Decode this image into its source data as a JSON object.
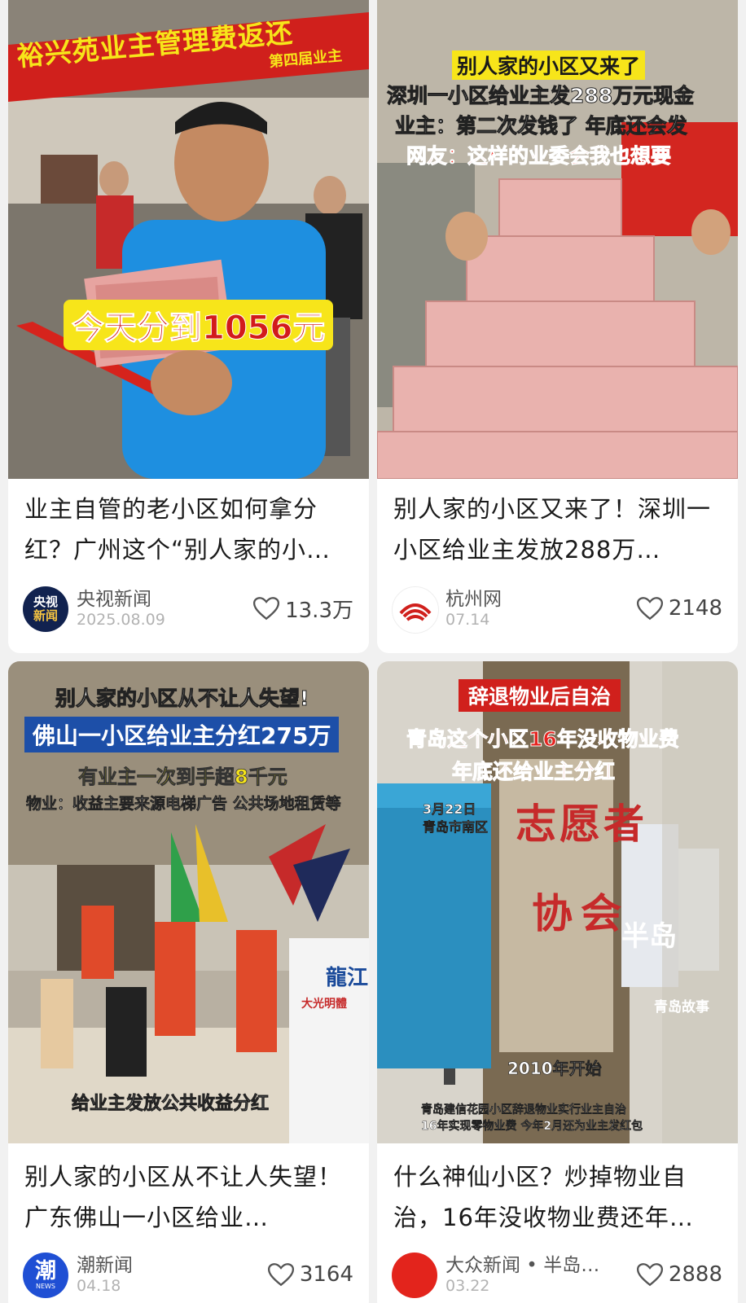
{
  "feed": {
    "cards": [
      {
        "title": "业主自管的老小区如何拿分红？广州这个“别人家的小…",
        "source": "央视新闻",
        "date": "2025.08.09",
        "likes": "13.3万",
        "avatar_text": [
          "央视",
          "新闻"
        ],
        "overlay": {
          "banner_main": "裕兴苑业主管理费返还",
          "banner_sub": "第四届业主",
          "sticker": "今天分到1056元"
        }
      },
      {
        "title": "别人家的小区又来了！深圳一小区给业主发放288万…",
        "source": "杭州网",
        "date": "07.14",
        "likes": "2148",
        "overlay": {
          "line1": "别人家的小区又来了",
          "line2": "深圳一小区给业主发288万元现金",
          "line3": "业主：第二次发钱了 年底还会发",
          "line4": "网友：这样的业委会我也想要"
        }
      },
      {
        "title": "别人家的小区从不让人失望！广东佛山一小区给业…",
        "source": "潮新闻",
        "date": "04.18",
        "likes": "3164",
        "avatar_text": [
          "潮",
          "NEWS"
        ],
        "overlay": {
          "line1": "别人家的小区从不让人失望!",
          "line2": "佛山一小区给业主分红275万",
          "line3": "有业主一次到手超8千元",
          "line4": "物业：收益主要来源电梯广告 公共场地租赁等",
          "bottom": "给业主发放公共收益分红",
          "shirt": "龍江",
          "shirt_sub": "大光明體"
        }
      },
      {
        "title": "什么神仙小区？炒掉物业自治，16年没收物业费还年…",
        "source": "大众新闻 • 半岛…",
        "date": "03.22",
        "likes": "2888",
        "overlay": {
          "line1": "辞退物业后自治",
          "line2": "青岛这个小区16年没收物业费",
          "line3": "年底还给业主分红",
          "date_line1": "3月22日",
          "date_line2": "青岛市南区",
          "wall1": "志愿者",
          "wall2": "协会",
          "brand": "半岛",
          "brand_sub": "青岛故事",
          "year": "2010年开始",
          "bottom1": "青岛建信花园小区辞退物业实行业主自治",
          "bottom2": "16年实现零物业费 今年2月还为业主发红包"
        }
      }
    ]
  },
  "colors": {
    "banner_red": "#d0201c",
    "caption_yellow": "#f7e51a",
    "caption_blue_box": "#1d4fa8",
    "like_icon": "#555555"
  }
}
